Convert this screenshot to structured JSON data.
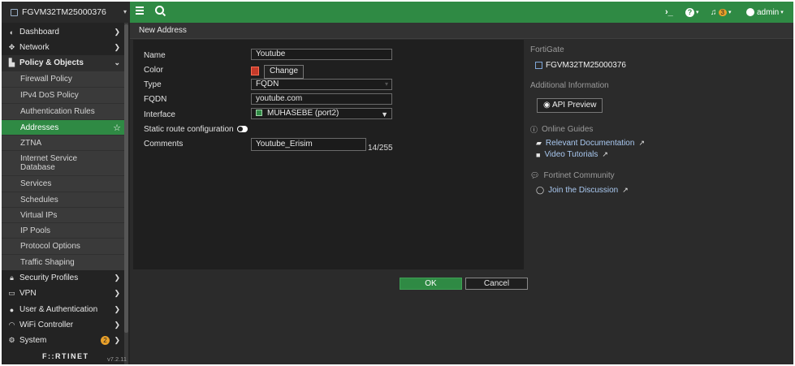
{
  "topbar": {
    "hostname": "FGVM32TM25000376",
    "cli_glyph": "›_",
    "help_glyph": "?",
    "alert_count": "3",
    "user": "admin"
  },
  "sidebar": {
    "top_items": [
      {
        "label": "Dashboard",
        "icon": "dashboard-icon"
      },
      {
        "label": "Network",
        "icon": "network-icon"
      },
      {
        "label": "Policy & Objects",
        "icon": "policy-icon"
      }
    ],
    "sub_items": [
      {
        "label": "Firewall Policy"
      },
      {
        "label": "IPv4 DoS Policy"
      },
      {
        "label": "Authentication Rules"
      },
      {
        "label": "Addresses",
        "active": true
      },
      {
        "label": "ZTNA"
      },
      {
        "label": "Internet Service Database"
      },
      {
        "label": "Services"
      },
      {
        "label": "Schedules"
      },
      {
        "label": "Virtual IPs"
      },
      {
        "label": "IP Pools"
      },
      {
        "label": "Protocol Options"
      },
      {
        "label": "Traffic Shaping"
      }
    ],
    "bottom_items": [
      {
        "label": "Security Profiles",
        "icon": "lock-icon"
      },
      {
        "label": "VPN",
        "icon": "monitor-icon"
      },
      {
        "label": "User & Authentication",
        "icon": "user-icon"
      },
      {
        "label": "WiFi Controller",
        "icon": "wifi-icon"
      },
      {
        "label": "System",
        "icon": "gear-icon",
        "badge": "2"
      }
    ],
    "logo": "F::RTINET",
    "version": "v7.2.11"
  },
  "page": {
    "title": "New Address"
  },
  "form": {
    "name_label": "Name",
    "name_value": "Youtube",
    "color_label": "Color",
    "change_label": "Change",
    "swatch_color": "#c43a2a",
    "type_label": "Type",
    "type_value": "FQDN",
    "fqdn_label": "FQDN",
    "fqdn_value": "youtube.com",
    "interface_label": "Interface",
    "interface_value": "MUHASEBE (port2)",
    "static_route_label": "Static route configuration",
    "comments_label": "Comments",
    "comments_value": "Youtube_Erisim",
    "comments_counter": "14/255",
    "ok_label": "OK",
    "cancel_label": "Cancel"
  },
  "info": {
    "fortigate_header": "FortiGate",
    "device_name": "FGVM32TM25000376",
    "additional_header": "Additional Information",
    "api_preview": "API Preview",
    "online_guides": "Online Guides",
    "relevant_docs": "Relevant Documentation",
    "video_tutorials": "Video Tutorials",
    "community_header": "Fortinet Community",
    "join_discussion": "Join the Discussion"
  },
  "colors": {
    "accent": "#2f8a44",
    "sidebar_bg": "#232323",
    "link": "#a9c8f0"
  }
}
